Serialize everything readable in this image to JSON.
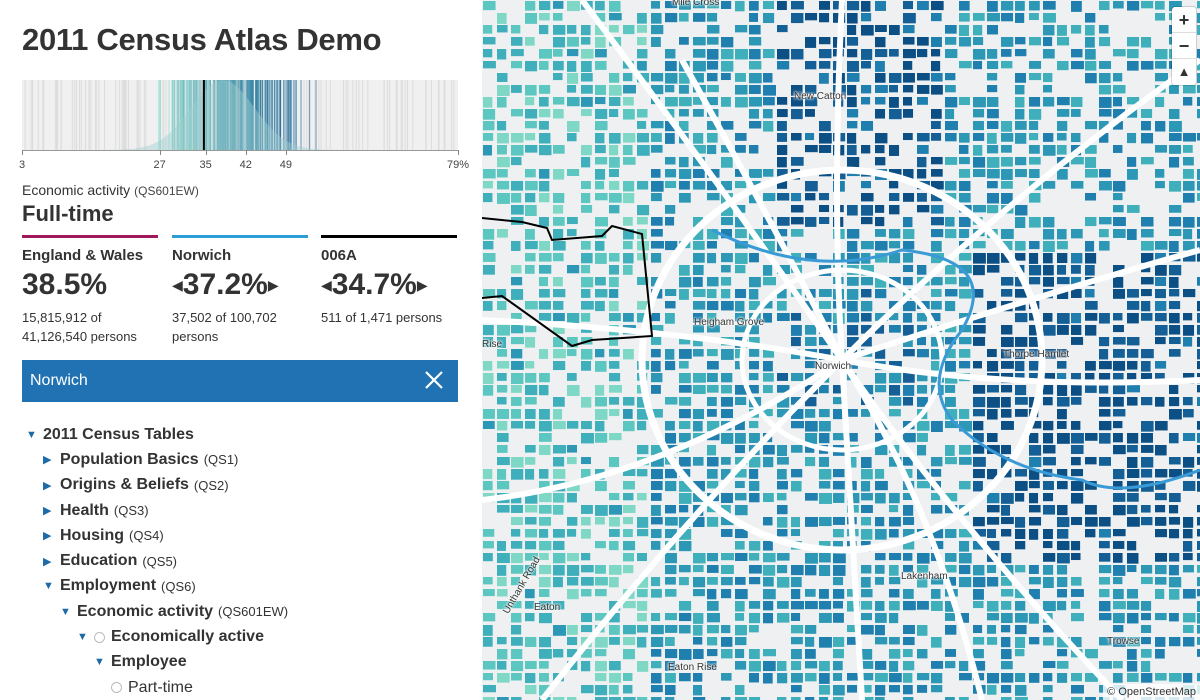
{
  "app": {
    "title": "2011 Census Atlas Demo"
  },
  "histogram": {
    "ticks": [
      {
        "value": 3,
        "label": "3"
      },
      {
        "value": 27,
        "label": "27"
      },
      {
        "value": 35,
        "label": "35"
      },
      {
        "value": 42,
        "label": "42"
      },
      {
        "value": 49,
        "label": "49"
      },
      {
        "value": 79,
        "label": "79%"
      }
    ],
    "range": [
      3,
      79
    ],
    "selected_marker": 34.7,
    "colors": {
      "background": "#f0f0f0",
      "low": "#8fe3cf",
      "high": "#0a5c91",
      "marker": "#000000"
    }
  },
  "variable": {
    "group": "Economic activity",
    "code": "(QS601EW)",
    "name": "Full-time"
  },
  "stats": [
    {
      "name": "England & Wales",
      "value": "38.5%",
      "count_line1": "15,815,912 of",
      "count_line2": "41,126,540 persons",
      "color": "#a2195b",
      "arrows": false
    },
    {
      "name": "Norwich",
      "value": "37.2%",
      "count_line1": "37,502 of 100,702",
      "count_line2": "persons",
      "color": "#2b9ed8",
      "arrows": true
    },
    {
      "name": "006A",
      "value": "34.7%",
      "count_line1": "511 of 1,471 persons",
      "count_line2": "",
      "color": "#000000",
      "arrows": true
    }
  ],
  "search": {
    "value": "Norwich",
    "close_icon": "close-icon"
  },
  "tree": [
    {
      "label": "2011 Census Tables",
      "code": "",
      "indent": 0,
      "icon": "caret-down"
    },
    {
      "label": "Population Basics",
      "code": "(QS1)",
      "indent": 1,
      "icon": "caret-right"
    },
    {
      "label": "Origins & Beliefs",
      "code": "(QS2)",
      "indent": 1,
      "icon": "caret-right"
    },
    {
      "label": "Health",
      "code": "(QS3)",
      "indent": 1,
      "icon": "caret-right"
    },
    {
      "label": "Housing",
      "code": "(QS4)",
      "indent": 1,
      "icon": "caret-right"
    },
    {
      "label": "Education",
      "code": "(QS5)",
      "indent": 1,
      "icon": "caret-right"
    },
    {
      "label": "Employment",
      "code": "(QS6)",
      "indent": 1,
      "icon": "caret-down"
    },
    {
      "label": "Economic activity",
      "code": "(QS601EW)",
      "indent": 2,
      "icon": "caret-down"
    },
    {
      "label": "Economically active",
      "code": "",
      "indent": 3,
      "icon": "caret-down-radio"
    },
    {
      "label": "Employee",
      "code": "",
      "indent": 4,
      "icon": "caret-down"
    },
    {
      "label": "Part-time",
      "code": "",
      "indent": 5,
      "icon": "radio"
    }
  ],
  "map": {
    "labels": [
      "Mile Cross",
      "New Catton",
      "Heigham Grove",
      "Norwich",
      "Thorpe Hamlet",
      "Lakenham",
      "Eaton",
      "Eaton Rise",
      "Trowse",
      "Rise",
      "Unthank Road"
    ],
    "attribution": "© OpenStreetMap",
    "zoom_in": "+",
    "zoom_out": "−",
    "compass": "▲"
  }
}
